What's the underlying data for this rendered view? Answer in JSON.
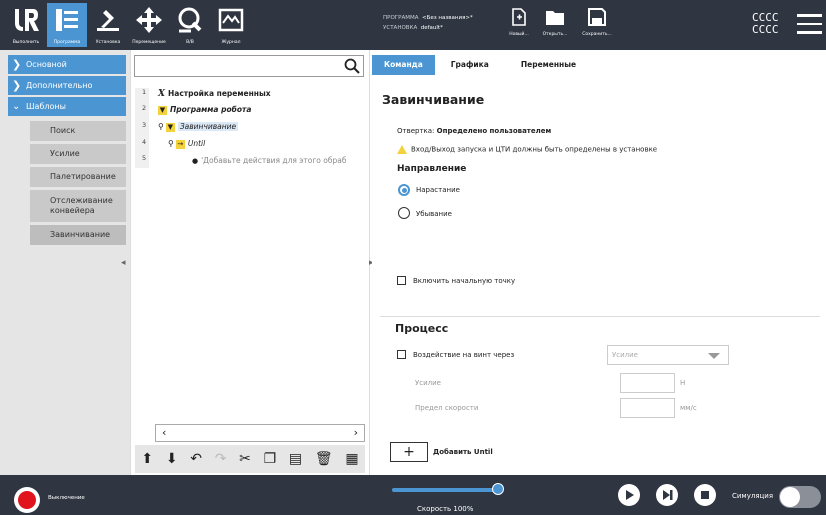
{
  "header": {
    "buttons": [
      {
        "label": "Выполнить",
        "icon": "ur-logo-icon"
      },
      {
        "label": "Программа",
        "icon": "program-icon"
      },
      {
        "label": "Установка",
        "icon": "installation-icon"
      },
      {
        "label": "Перемещение",
        "icon": "move-icon"
      },
      {
        "label": "В/В",
        "icon": "io-icon"
      },
      {
        "label": "Журнал",
        "icon": "log-icon"
      }
    ],
    "program_label": "ПРОГРАММА",
    "program_name": "<Без названия>*",
    "install_label": "УСТАНОВКА",
    "install_name": "default*",
    "file_buttons": [
      {
        "label": "Новый...",
        "icon": "new-file-icon"
      },
      {
        "label": "Открыть...",
        "icon": "open-folder-icon"
      },
      {
        "label": "Сохранить...",
        "icon": "save-icon"
      }
    ],
    "user_line1": "CCCC",
    "user_line2": "CCCC"
  },
  "left_nav": {
    "sections": [
      {
        "label": "Основной",
        "expanded": false
      },
      {
        "label": "Дополнительно",
        "expanded": false
      },
      {
        "label": "Шаблоны",
        "expanded": true
      }
    ],
    "template_items": [
      "Поиск",
      "Усилие",
      "Палетирование",
      "Отслеживание конвейера",
      "Завинчивание"
    ]
  },
  "tree": {
    "search_placeholder": "",
    "rows": [
      {
        "num": "1",
        "icon": "X",
        "text": "Настройка переменных"
      },
      {
        "num": "2",
        "icon": "▼",
        "text": "Программа робота"
      },
      {
        "num": "3",
        "icon": "▼",
        "text": "Завинчивание"
      },
      {
        "num": "4",
        "icon": "→",
        "text": "Until"
      },
      {
        "num": "5",
        "icon": "●",
        "text": "'Добавьте действия для этого обраб"
      }
    ]
  },
  "tabs": [
    {
      "label": "Команда",
      "active": true
    },
    {
      "label": "Графика",
      "active": false
    },
    {
      "label": "Переменные",
      "active": false
    }
  ],
  "command": {
    "title": "Завинчивание",
    "screwdriver_label": "Отвертка:",
    "screwdriver_value": "Определено пользователем",
    "warning": "Вход/Выход запуска и ЦТИ должны быть определены в установке",
    "direction_title": "Направление",
    "direction_options": [
      {
        "label": "Нарастание",
        "selected": true
      },
      {
        "label": "Убывание",
        "selected": false
      }
    ],
    "start_point_label": "Включить начальную точку",
    "start_point_checked": false,
    "process_title": "Процесс",
    "impact_label": "Воздействие на винт через",
    "impact_checked": false,
    "impact_dropdown": "Усилие",
    "force_label": "Усилие",
    "force_unit": "Н",
    "speed_label": "Предел скорости",
    "speed_unit": "мм/с",
    "add_until_label": "Добавить Until"
  },
  "footer": {
    "power_status": "Выключение",
    "speed_text": "Скорость 100%",
    "speed_value": 1.0,
    "simulation_label": "Симуляция",
    "simulation_on": false
  },
  "colors": {
    "accent": "#4b96d2",
    "topbar": "#2f3541",
    "power": "#e1141e",
    "warning": "#f4d23c"
  }
}
